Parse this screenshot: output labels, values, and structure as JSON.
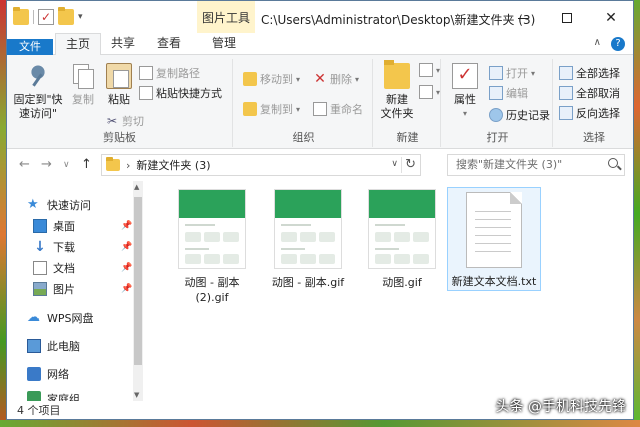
{
  "title_bar": {
    "context_tab": "图片工具",
    "path_title": "C:\\Users\\Administrator\\Desktop\\新建文件夹 (3)",
    "minimize_glyph": "—",
    "maximize_glyph": "□",
    "close_glyph": "✕"
  },
  "tabs": {
    "file": "文件",
    "home": "主页",
    "share": "共享",
    "view": "查看",
    "manage": "管理"
  },
  "ribbon": {
    "clipboard": {
      "label": "剪贴板",
      "pin_quick": "固定到\"快\n速访问\"",
      "copy": "复制",
      "paste": "粘贴",
      "copy_path": "复制路径",
      "paste_shortcut": "粘贴快捷方式",
      "cut": "剪切"
    },
    "organize": {
      "label": "组织",
      "move_to": "移动到",
      "copy_to": "复制到",
      "delete": "删除",
      "rename": "重命名"
    },
    "new": {
      "label": "新建",
      "new_folder": "新建\n文件夹"
    },
    "open": {
      "label": "打开",
      "properties": "属性",
      "open": "打开",
      "edit": "编辑",
      "history": "历史记录"
    },
    "select": {
      "label": "选择",
      "select_all": "全部选择",
      "select_none": "全部取消",
      "invert": "反向选择"
    }
  },
  "address": {
    "folder": "新建文件夹 (3)",
    "search_placeholder": "搜索\"新建文件夹 (3)\""
  },
  "nav_pane": {
    "quick_access": "快速访问",
    "desktop": "桌面",
    "downloads": "下载",
    "documents": "文档",
    "pictures": "图片",
    "wps": "WPS网盘",
    "this_pc": "此电脑",
    "network": "网络",
    "homegroup": "家庭组"
  },
  "files": [
    {
      "name": "动图 - 副本\n(2).gif",
      "type": "gif"
    },
    {
      "name": "动图 - 副本.gif",
      "type": "gif"
    },
    {
      "name": "动图.gif",
      "type": "gif"
    },
    {
      "name": "新建文本文档.txt",
      "type": "txt"
    }
  ],
  "status": {
    "count": "4 个项目"
  },
  "watermark": "头条 @手机科技先锋",
  "colors": {
    "file_tab": "#1979ca",
    "context_tab": "#fff4cc",
    "selection": "#eaf4fd",
    "gif_header": "#2ba25a"
  }
}
